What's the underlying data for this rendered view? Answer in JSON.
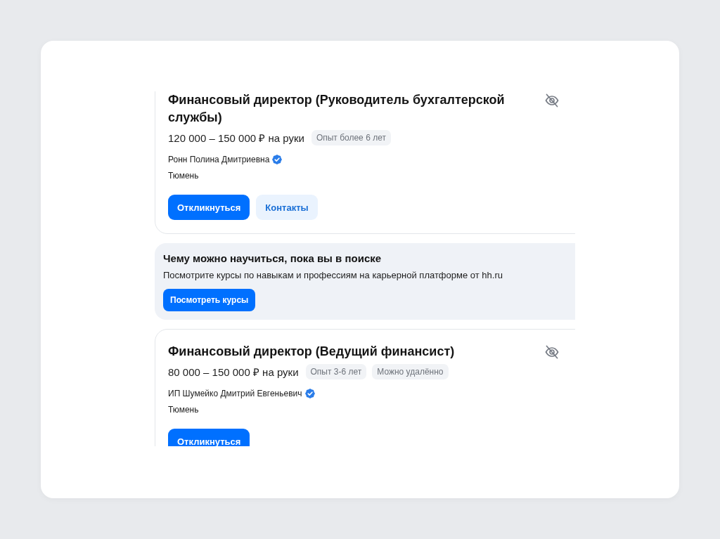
{
  "feed": [
    {
      "kind": "vacancy",
      "title": "Финансовый директор (Руководитель бухгалтерской службы)",
      "salary": "120 000 – 150 000 ₽ на руки",
      "tags": [
        "Опыт более 6 лет"
      ],
      "employer": "Ронн Полина Дмитриевна",
      "verified": true,
      "city": "Тюмень",
      "buttons": [
        {
          "label": "Откликнуться",
          "kind": "apply"
        },
        {
          "label": "Контакты",
          "kind": "contacts"
        }
      ]
    },
    {
      "kind": "promo",
      "title": "Чему можно научиться, пока вы в поиске",
      "text": "Посмотрите курсы по навыкам и профессиям на карьерной платформе от hh.ru",
      "button": "Посмотреть курсы"
    },
    {
      "kind": "vacancy",
      "title": "Финансовый директор (Ведущий финансист)",
      "salary": "80 000 – 150 000 ₽ на руки",
      "tags": [
        "Опыт 3-6 лет",
        "Можно удалённо"
      ],
      "employer": "ИП Шумейко Дмитрий Евгеньевич",
      "verified": true,
      "city": "Тюмень",
      "buttons": [
        {
          "label": "Откликнуться",
          "kind": "apply"
        }
      ]
    }
  ]
}
